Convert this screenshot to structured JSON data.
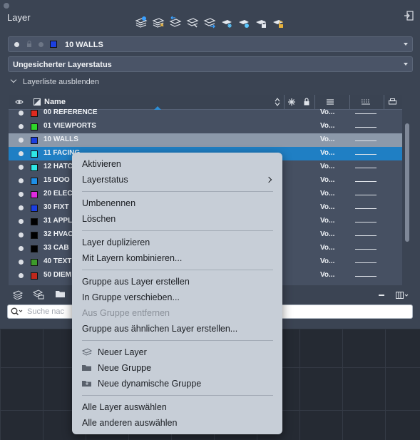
{
  "palette": {
    "title": "Layer",
    "current_layer": "10 WALLS",
    "current_layer_color": "#1b3fe0",
    "layer_state": "Ungesicherter Layerstatus",
    "hide_list_label": "Layerliste ausblenden",
    "column_name": "Name",
    "search_placeholder": "Suche nac"
  },
  "layers": [
    {
      "name": "00 REFERENCE",
      "color": "#e02a1f",
      "linetype": "Vo..."
    },
    {
      "name": "01 VIEWPORTS",
      "color": "#2fd62a",
      "linetype": "Vo..."
    },
    {
      "name": "10 WALLS",
      "color": "#1b3fe0",
      "linetype": "Vo..."
    },
    {
      "name": "11 FACING",
      "color": "#2fe6e6",
      "linetype": "Vo..."
    },
    {
      "name": "12 HATC",
      "color": "#2fe6e6",
      "linetype": "Vo..."
    },
    {
      "name": "15 DOO",
      "color": "#1f8fe6",
      "linetype": "Vo..."
    },
    {
      "name": "20 ELEC",
      "color": "#e02ae0",
      "linetype": "Vo..."
    },
    {
      "name": "30 FIXT",
      "color": "#1b3fe0",
      "linetype": "Vo..."
    },
    {
      "name": "31 APPL",
      "color": "#000000",
      "linetype": "Vo..."
    },
    {
      "name": "32 HVAC",
      "color": "#000000",
      "linetype": "Vo..."
    },
    {
      "name": "33 CAB",
      "color": "#000000",
      "linetype": "Vo..."
    },
    {
      "name": "40 TEXT",
      "color": "#3d9b2b",
      "linetype": "Vo..."
    },
    {
      "name": "50 DIEM",
      "color": "#c0281d",
      "linetype": "Vo..."
    }
  ],
  "menu": {
    "activate": "Aktivieren",
    "layer_state": "Layerstatus",
    "rename": "Umbenennen",
    "delete": "Löschen",
    "duplicate": "Layer duplizieren",
    "merge": "Mit Layern kombinieren...",
    "group_from_layer": "Gruppe aus Layer erstellen",
    "move_to_group": "In Gruppe verschieben...",
    "remove_from_group": "Aus Gruppe entfernen",
    "group_from_similar": "Gruppe aus ähnlichen Layer erstellen...",
    "new_layer": "Neuer Layer",
    "new_group": "Neue Gruppe",
    "new_dynamic_group": "Neue dynamische Gruppe",
    "select_all": "Alle Layer auswählen",
    "select_others": "Alle anderen auswählen"
  }
}
